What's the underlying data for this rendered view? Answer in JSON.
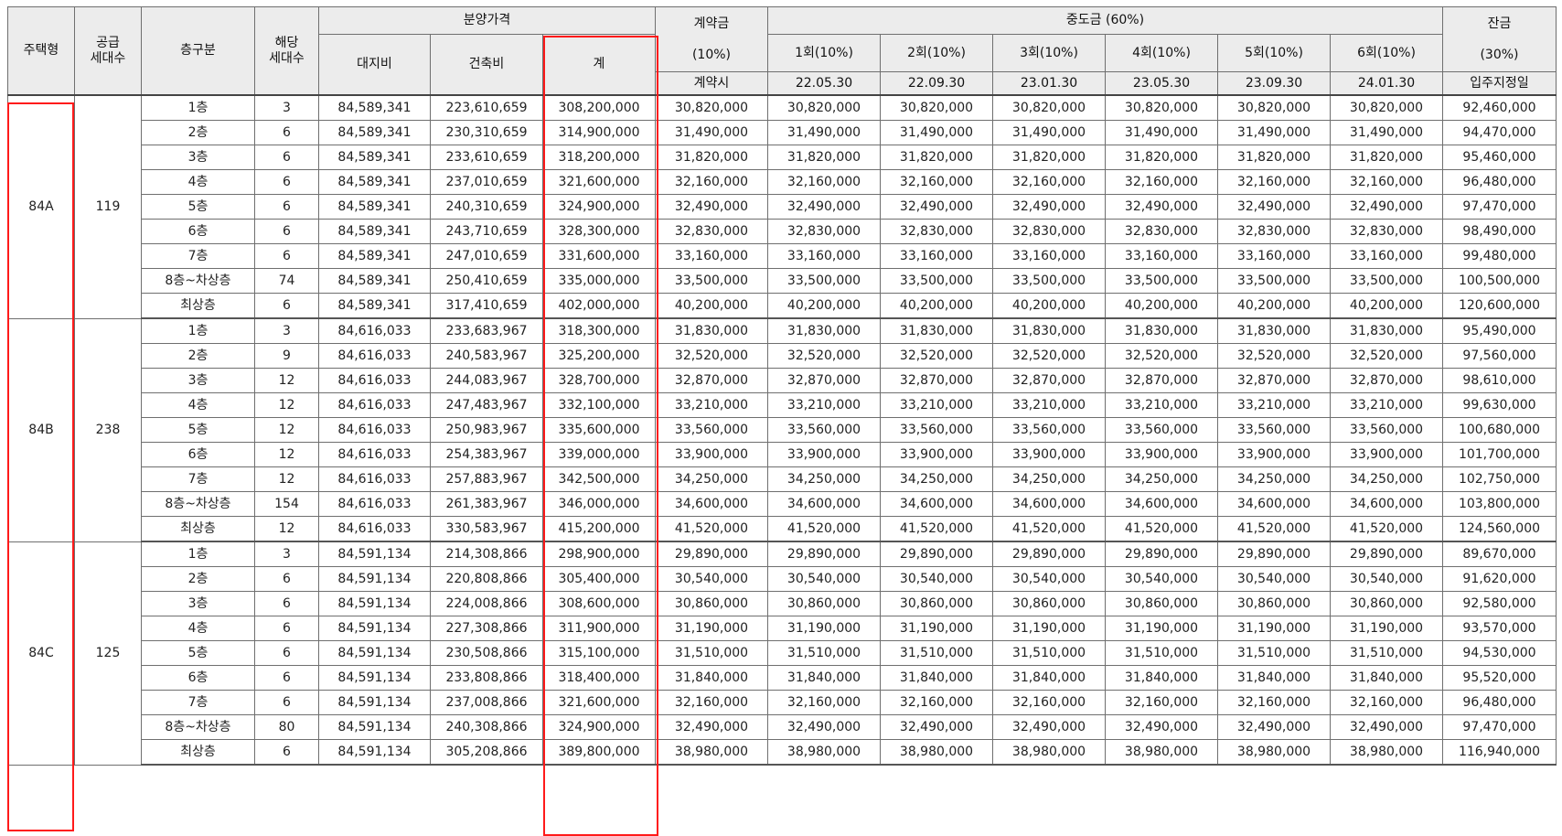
{
  "header": {
    "type": "주택형",
    "supply": "공급\n세대수",
    "floor": "층구분",
    "units": "해당\n세대수",
    "price": "분양가격",
    "land": "대지비",
    "build": "건축비",
    "total": "계",
    "contract": "계약금",
    "contract_pct": "(10%)",
    "contract_when": "계약시",
    "middle": "중도금 (60%)",
    "middle_cols": [
      {
        "label": "1회(10%)",
        "date": "22.05.30"
      },
      {
        "label": "2회(10%)",
        "date": "22.09.30"
      },
      {
        "label": "3회(10%)",
        "date": "23.01.30"
      },
      {
        "label": "4회(10%)",
        "date": "23.05.30"
      },
      {
        "label": "5회(10%)",
        "date": "23.09.30"
      },
      {
        "label": "6회(10%)",
        "date": "24.01.30"
      }
    ],
    "balance": "잔금",
    "balance_pct": "(30%)",
    "balance_when": "입주지정일"
  },
  "groups": [
    {
      "type": "84A",
      "supply": "119",
      "land": "84,589,341",
      "rows": [
        {
          "floor": "1층",
          "units": "3",
          "build": "223,610,659",
          "total": "308,200,000",
          "pay": "30,820,000",
          "balance": "92,460,000"
        },
        {
          "floor": "2층",
          "units": "6",
          "build": "230,310,659",
          "total": "314,900,000",
          "pay": "31,490,000",
          "balance": "94,470,000"
        },
        {
          "floor": "3층",
          "units": "6",
          "build": "233,610,659",
          "total": "318,200,000",
          "pay": "31,820,000",
          "balance": "95,460,000"
        },
        {
          "floor": "4층",
          "units": "6",
          "build": "237,010,659",
          "total": "321,600,000",
          "pay": "32,160,000",
          "balance": "96,480,000"
        },
        {
          "floor": "5층",
          "units": "6",
          "build": "240,310,659",
          "total": "324,900,000",
          "pay": "32,490,000",
          "balance": "97,470,000"
        },
        {
          "floor": "6층",
          "units": "6",
          "build": "243,710,659",
          "total": "328,300,000",
          "pay": "32,830,000",
          "balance": "98,490,000"
        },
        {
          "floor": "7층",
          "units": "6",
          "build": "247,010,659",
          "total": "331,600,000",
          "pay": "33,160,000",
          "balance": "99,480,000"
        },
        {
          "floor": "8층~차상층",
          "units": "74",
          "build": "250,410,659",
          "total": "335,000,000",
          "pay": "33,500,000",
          "balance": "100,500,000"
        },
        {
          "floor": "최상층",
          "units": "6",
          "build": "317,410,659",
          "total": "402,000,000",
          "pay": "40,200,000",
          "balance": "120,600,000"
        }
      ]
    },
    {
      "type": "84B",
      "supply": "238",
      "land": "84,616,033",
      "rows": [
        {
          "floor": "1층",
          "units": "3",
          "build": "233,683,967",
          "total": "318,300,000",
          "pay": "31,830,000",
          "balance": "95,490,000"
        },
        {
          "floor": "2층",
          "units": "9",
          "build": "240,583,967",
          "total": "325,200,000",
          "pay": "32,520,000",
          "balance": "97,560,000"
        },
        {
          "floor": "3층",
          "units": "12",
          "build": "244,083,967",
          "total": "328,700,000",
          "pay": "32,870,000",
          "balance": "98,610,000"
        },
        {
          "floor": "4층",
          "units": "12",
          "build": "247,483,967",
          "total": "332,100,000",
          "pay": "33,210,000",
          "balance": "99,630,000"
        },
        {
          "floor": "5층",
          "units": "12",
          "build": "250,983,967",
          "total": "335,600,000",
          "pay": "33,560,000",
          "balance": "100,680,000"
        },
        {
          "floor": "6층",
          "units": "12",
          "build": "254,383,967",
          "total": "339,000,000",
          "pay": "33,900,000",
          "balance": "101,700,000"
        },
        {
          "floor": "7층",
          "units": "12",
          "build": "257,883,967",
          "total": "342,500,000",
          "pay": "34,250,000",
          "balance": "102,750,000"
        },
        {
          "floor": "8층~차상층",
          "units": "154",
          "build": "261,383,967",
          "total": "346,000,000",
          "pay": "34,600,000",
          "balance": "103,800,000"
        },
        {
          "floor": "최상층",
          "units": "12",
          "build": "330,583,967",
          "total": "415,200,000",
          "pay": "41,520,000",
          "balance": "124,560,000"
        }
      ]
    },
    {
      "type": "84C",
      "supply": "125",
      "land": "84,591,134",
      "rows": [
        {
          "floor": "1층",
          "units": "3",
          "build": "214,308,866",
          "total": "298,900,000",
          "pay": "29,890,000",
          "balance": "89,670,000"
        },
        {
          "floor": "2층",
          "units": "6",
          "build": "220,808,866",
          "total": "305,400,000",
          "pay": "30,540,000",
          "balance": "91,620,000"
        },
        {
          "floor": "3층",
          "units": "6",
          "build": "224,008,866",
          "total": "308,600,000",
          "pay": "30,860,000",
          "balance": "92,580,000"
        },
        {
          "floor": "4층",
          "units": "6",
          "build": "227,308,866",
          "total": "311,900,000",
          "pay": "31,190,000",
          "balance": "93,570,000"
        },
        {
          "floor": "5층",
          "units": "6",
          "build": "230,508,866",
          "total": "315,100,000",
          "pay": "31,510,000",
          "balance": "94,530,000"
        },
        {
          "floor": "6층",
          "units": "6",
          "build": "233,808,866",
          "total": "318,400,000",
          "pay": "31,840,000",
          "balance": "95,520,000"
        },
        {
          "floor": "7층",
          "units": "6",
          "build": "237,008,866",
          "total": "321,600,000",
          "pay": "32,160,000",
          "balance": "96,480,000"
        },
        {
          "floor": "8층~차상층",
          "units": "80",
          "build": "240,308,866",
          "total": "324,900,000",
          "pay": "32,490,000",
          "balance": "97,470,000"
        },
        {
          "floor": "최상층",
          "units": "6",
          "build": "305,208,866",
          "total": "389,800,000",
          "pay": "38,980,000",
          "balance": "116,940,000"
        }
      ]
    }
  ],
  "colors": {
    "highlight": "#ff1a1a",
    "header_bg": "#ececec",
    "border": "#6f6f6f"
  }
}
